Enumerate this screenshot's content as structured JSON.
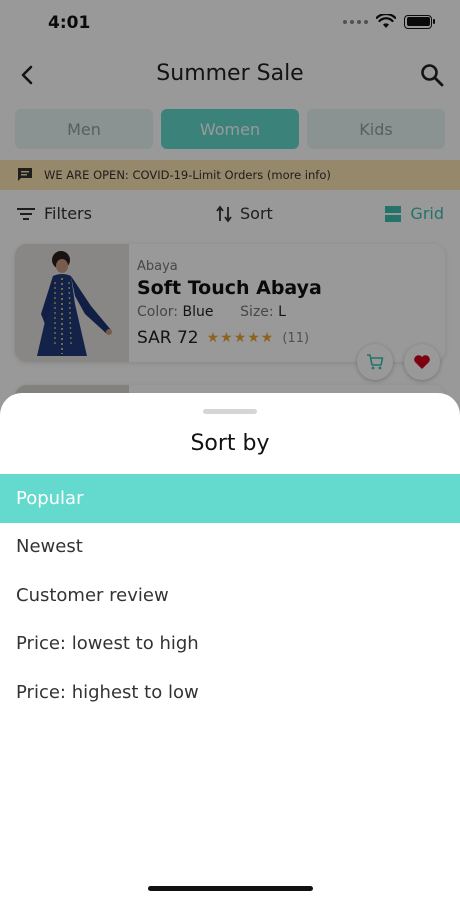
{
  "status_bar": {
    "time": "4:01"
  },
  "header": {
    "title": "Summer Sale"
  },
  "tabs": [
    {
      "label": "Men",
      "active": false
    },
    {
      "label": "Women",
      "active": true
    },
    {
      "label": "Kids",
      "active": false
    }
  ],
  "notice": {
    "text": "WE ARE OPEN: COVID-19-Limit Orders (more info)"
  },
  "toolbar": {
    "filters_label": "Filters",
    "sort_label": "Sort",
    "grid_label": "Grid"
  },
  "product": {
    "category": "Abaya",
    "name": "Soft Touch Abaya",
    "color_label": "Color:",
    "color_value": "Blue",
    "size_label": "Size:",
    "size_value": "L",
    "price": "SAR 72",
    "stars": "★★★★★",
    "rating": 5,
    "review_count": "(11)"
  },
  "sort_sheet": {
    "title": "Sort by",
    "options": [
      {
        "label": "Popular",
        "selected": true
      },
      {
        "label": "Newest",
        "selected": false
      },
      {
        "label": "Customer review",
        "selected": false
      },
      {
        "label": "Price: lowest to high",
        "selected": false
      },
      {
        "label": "Price: highest to low",
        "selected": false
      }
    ]
  },
  "colors": {
    "accent": "#61d9cc",
    "selected_row": "#64dace",
    "notice_bg": "#fbe3b3",
    "star": "#e9a73a",
    "heart": "#d0021b"
  },
  "icons": {
    "back": "chevron-left-icon",
    "search": "search-icon",
    "notice": "message-icon",
    "filters": "filter-icon",
    "sort": "sort-arrows-icon",
    "grid": "grid-icon",
    "cart": "cart-icon",
    "favorite": "heart-icon"
  }
}
